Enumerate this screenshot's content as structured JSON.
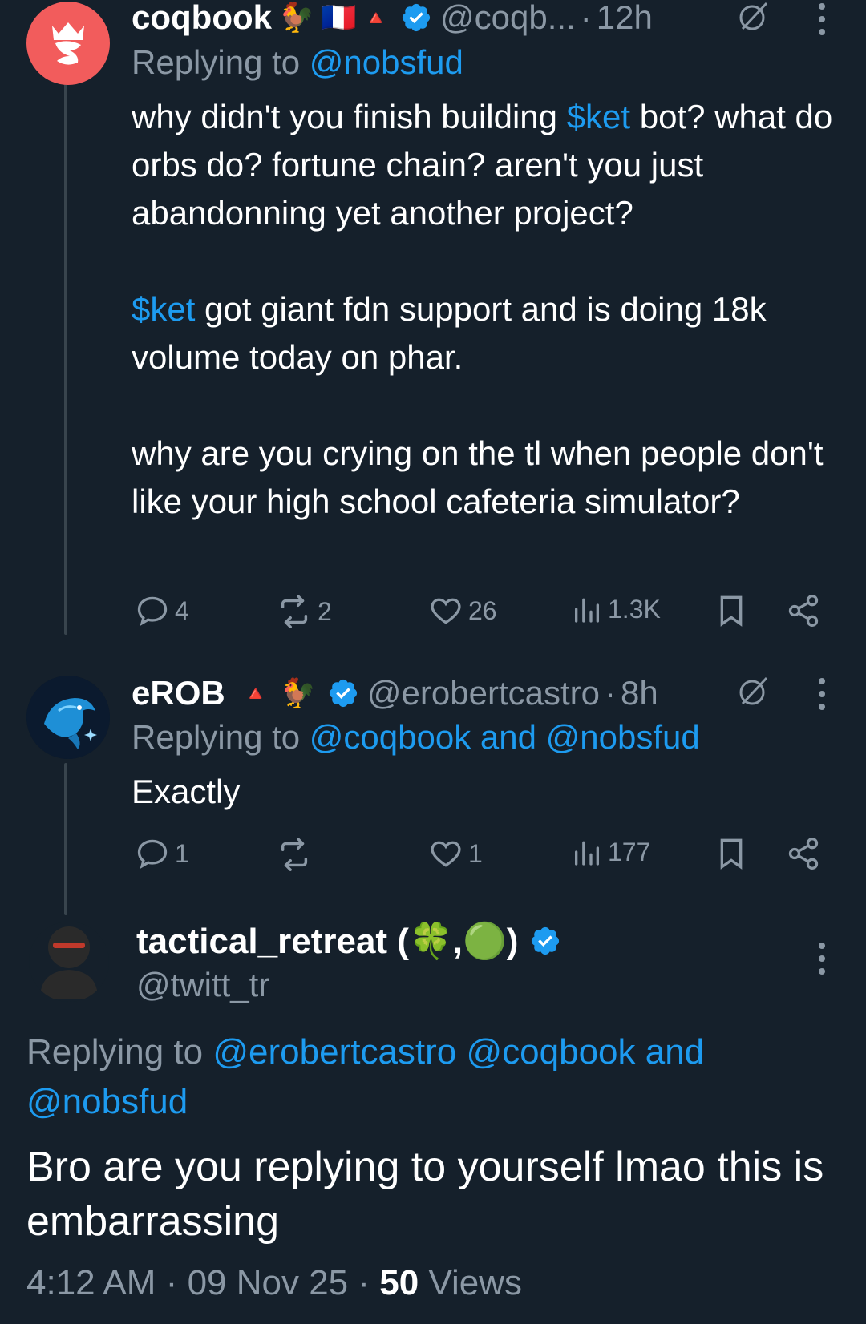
{
  "tweets": [
    {
      "display_name": "coqbook",
      "emojis": [
        "🐓",
        "🇫🇷",
        "🔺"
      ],
      "handle": "@coqb...",
      "time": "12h",
      "replying_prefix": "Replying to",
      "replying_to": "@nobsfud",
      "text_parts": {
        "p1_a": "why didn't you finish building ",
        "p1_tag": "$ket",
        "p1_b": " bot? what do orbs do? fortune chain? aren't you just abandonning yet another project?",
        "p2_tag": "$ket",
        "p2_b": " got giant fdn support and is doing 18k volume today on phar.",
        "p3": "why are you crying on the tl when people don't like your high school cafeteria simulator?"
      },
      "stats": {
        "replies": "4",
        "retweets": "2",
        "likes": "26",
        "views": "1.3K"
      }
    },
    {
      "display_name": "eROB",
      "emojis": [
        "🔺",
        "🐓"
      ],
      "handle": "@erobertcastro",
      "time": "8h",
      "replying_prefix": "Replying to",
      "replying_to": "@coqbook and @nobsfud",
      "text": "Exactly",
      "stats": {
        "replies": "1",
        "retweets": "",
        "likes": "1",
        "views": "177"
      }
    }
  ],
  "main_tweet": {
    "display_name": "tactical_retreat (🍀,🟢)",
    "handle": "@twitt_tr",
    "replying_prefix": "Replying to",
    "replying_line1": "@erobertcastro @coqbook and",
    "replying_line2": "@nobsfud",
    "text": "Bro are you replying to yourself lmao this is embarrassing",
    "time": "4:12 AM",
    "date": "09 Nov 25",
    "views_count": "50",
    "views_label": "Views"
  },
  "colors": {
    "background": "#15202b",
    "accent": "#1d9bf0",
    "muted": "#8b98a5",
    "thread_line": "#38444d",
    "avatar_coqbook": "#f25c5c"
  }
}
